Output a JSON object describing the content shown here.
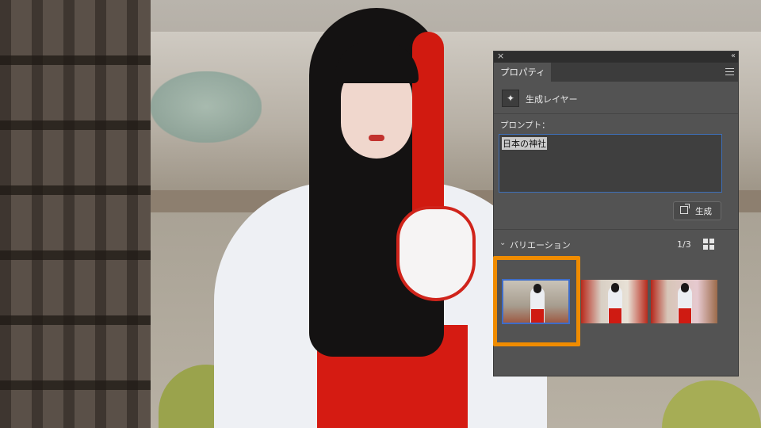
{
  "panel": {
    "close_glyph": "×",
    "collapse_glyph": "‹‹",
    "tab_label": "プロパティ",
    "menu_icon": "panel-menu-icon",
    "layer": {
      "icon": "sparkle-icon",
      "label": "生成レイヤー"
    },
    "prompt": {
      "label": "プロンプト：",
      "value": "日本の神社"
    },
    "generate_button": {
      "icon": "generate-icon",
      "label": "生成"
    },
    "variations": {
      "label": "バリエーション",
      "count": "1/3",
      "thumbnails": [
        {
          "selected": true
        },
        {
          "selected": false
        },
        {
          "selected": false
        }
      ]
    }
  },
  "colors": {
    "panel_bg": "#535353",
    "accent_blue": "#3e6fb8",
    "highlight_orange": "#f08c00"
  }
}
